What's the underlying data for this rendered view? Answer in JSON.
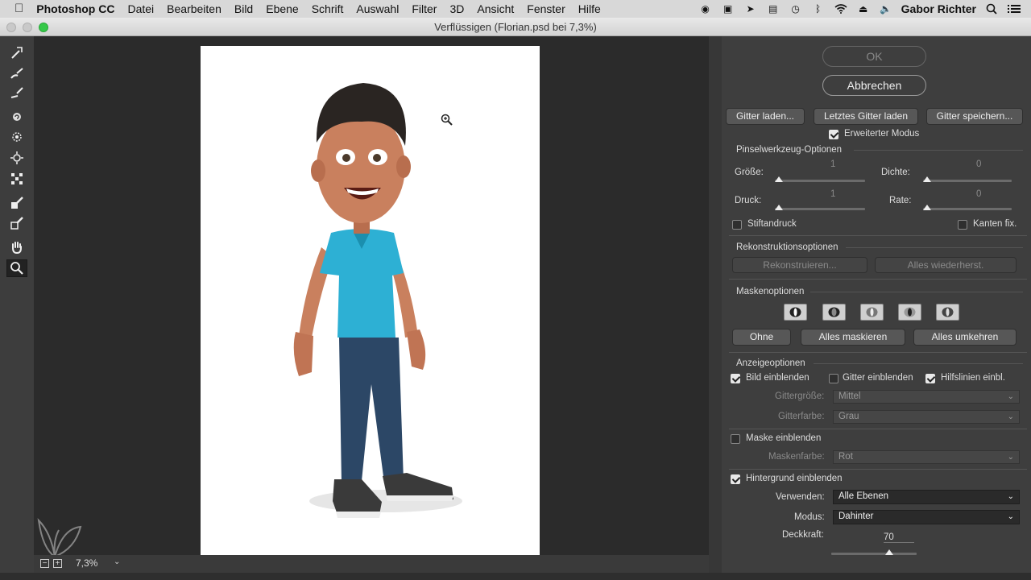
{
  "menubar": {
    "app": "Photoshop CC",
    "items": [
      "Datei",
      "Bearbeiten",
      "Bild",
      "Ebene",
      "Schrift",
      "Auswahl",
      "Filter",
      "3D",
      "Ansicht",
      "Fenster",
      "Hilfe"
    ],
    "user": "Gabor Richter"
  },
  "window": {
    "title": "Verflüssigen (Florian.psd bei 7,3%)"
  },
  "status": {
    "zoom": "7,3%"
  },
  "panel": {
    "ok": "OK",
    "cancel": "Abbrechen",
    "mesh_load": "Gitter laden...",
    "mesh_last": "Letztes Gitter laden",
    "mesh_save": "Gitter speichern...",
    "advanced_mode": "Erweiterter Modus",
    "brush_options": "Pinselwerkzeug-Optionen",
    "size_label": "Größe:",
    "size_value": "1",
    "density_label": "Dichte:",
    "density_value": "0",
    "pressure_label": "Druck:",
    "pressure_value": "1",
    "rate_label": "Rate:",
    "rate_value": "0",
    "stylus": "Stiftandruck",
    "pin_edges": "Kanten fix.",
    "reconstruct_options": "Rekonstruktionsoptionen",
    "reconstruct": "Rekonstruieren...",
    "restore_all": "Alles wiederherst.",
    "mask_options": "Maskenoptionen",
    "mask_none": "Ohne",
    "mask_all": "Alles maskieren",
    "mask_invert": "Alles umkehren",
    "view_options": "Anzeigeoptionen",
    "show_image": "Bild einblenden",
    "show_mesh": "Gitter einblenden",
    "show_guides": "Hilfslinien einbl.",
    "mesh_size_label": "Gittergröße:",
    "mesh_size_value": "Mittel",
    "mesh_color_label": "Gitterfarbe:",
    "mesh_color_value": "Grau",
    "show_mask": "Maske einblenden",
    "mask_color_label": "Maskenfarbe:",
    "mask_color_value": "Rot",
    "show_backdrop": "Hintergrund einblenden",
    "use_label": "Verwenden:",
    "use_value": "Alle Ebenen",
    "mode_label": "Modus:",
    "mode_value": "Dahinter",
    "opacity_label": "Deckkraft:",
    "opacity_value": "70"
  },
  "checks": {
    "advanced_mode": true,
    "stylus": false,
    "pin_edges": false,
    "show_image": true,
    "show_mesh": false,
    "show_guides": true,
    "show_mask": false,
    "show_backdrop": true
  },
  "sliders": {
    "size": 0.0,
    "density": 0.0,
    "pressure": 0.0,
    "rate": 0.0,
    "opacity": 0.7
  },
  "colors": {
    "shirt": "#2db0d4",
    "jeans": "#2c4766",
    "skin": "#c9805e",
    "hair": "#2a2522"
  }
}
